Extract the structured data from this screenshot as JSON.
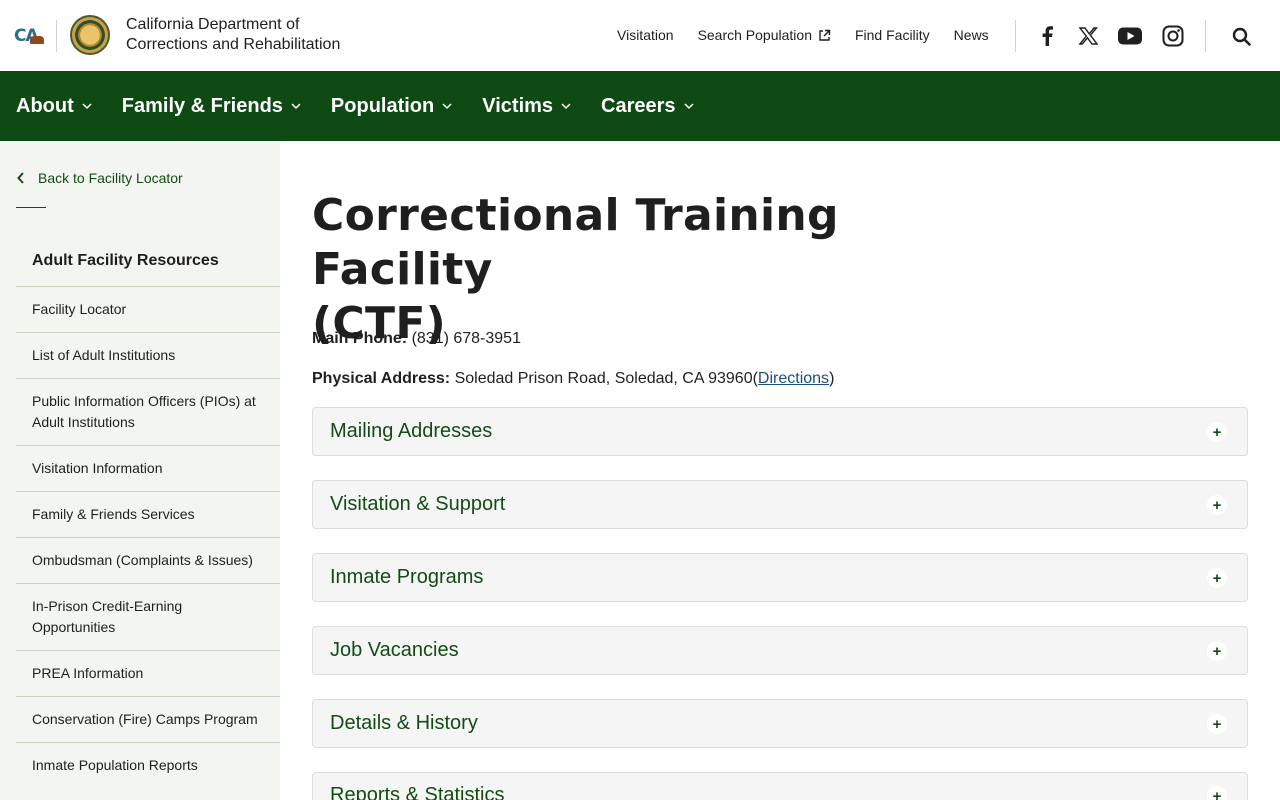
{
  "header": {
    "ca_logo_text": "CA",
    "org_line1": "California Department of",
    "org_line2": "Corrections and Rehabilitation",
    "util_links": [
      "Visitation",
      "Search Population",
      "Find Facility",
      "News"
    ],
    "social_icons": [
      "facebook-icon",
      "x-icon",
      "youtube-icon",
      "instagram-icon"
    ]
  },
  "main_nav": {
    "items": [
      "About",
      "Family & Friends",
      "Population",
      "Victims",
      "Careers"
    ]
  },
  "sidebar": {
    "back_label": "Back to Facility Locator",
    "heading": "Adult Facility Resources",
    "items": [
      "Facility Locator",
      "List of Adult Institutions",
      "Public Information Officers (PIOs) at Adult Institutions",
      "Visitation Information",
      "Family & Friends Services",
      "Ombudsman (Complaints & Issues)",
      "In-Prison Credit-Earning Opportunities",
      "PREA Information",
      "Conservation (Fire) Camps Program",
      "Inmate Population Reports"
    ]
  },
  "main": {
    "title_line1": "Correctional Training Facility",
    "title_line2": "(CTF)",
    "phone_label": "Main Phone:",
    "phone_value": "(831) 678-3951",
    "address_label": "Physical Address:",
    "address_value": "Soledad Prison Road, Soledad, CA 93960",
    "address_open_paren": "(",
    "directions_link": "Directions",
    "address_close_paren": ")",
    "accordions": [
      "Mailing Addresses",
      "Visitation & Support",
      "Inmate Programs",
      "Job Vacancies",
      "Details & History",
      "Reports & Statistics"
    ],
    "accordion_toggle": "+"
  },
  "colors": {
    "nav_green": "#0f4a14",
    "link_green": "#124c14",
    "sidebar_bg": "#f3f5f1"
  }
}
